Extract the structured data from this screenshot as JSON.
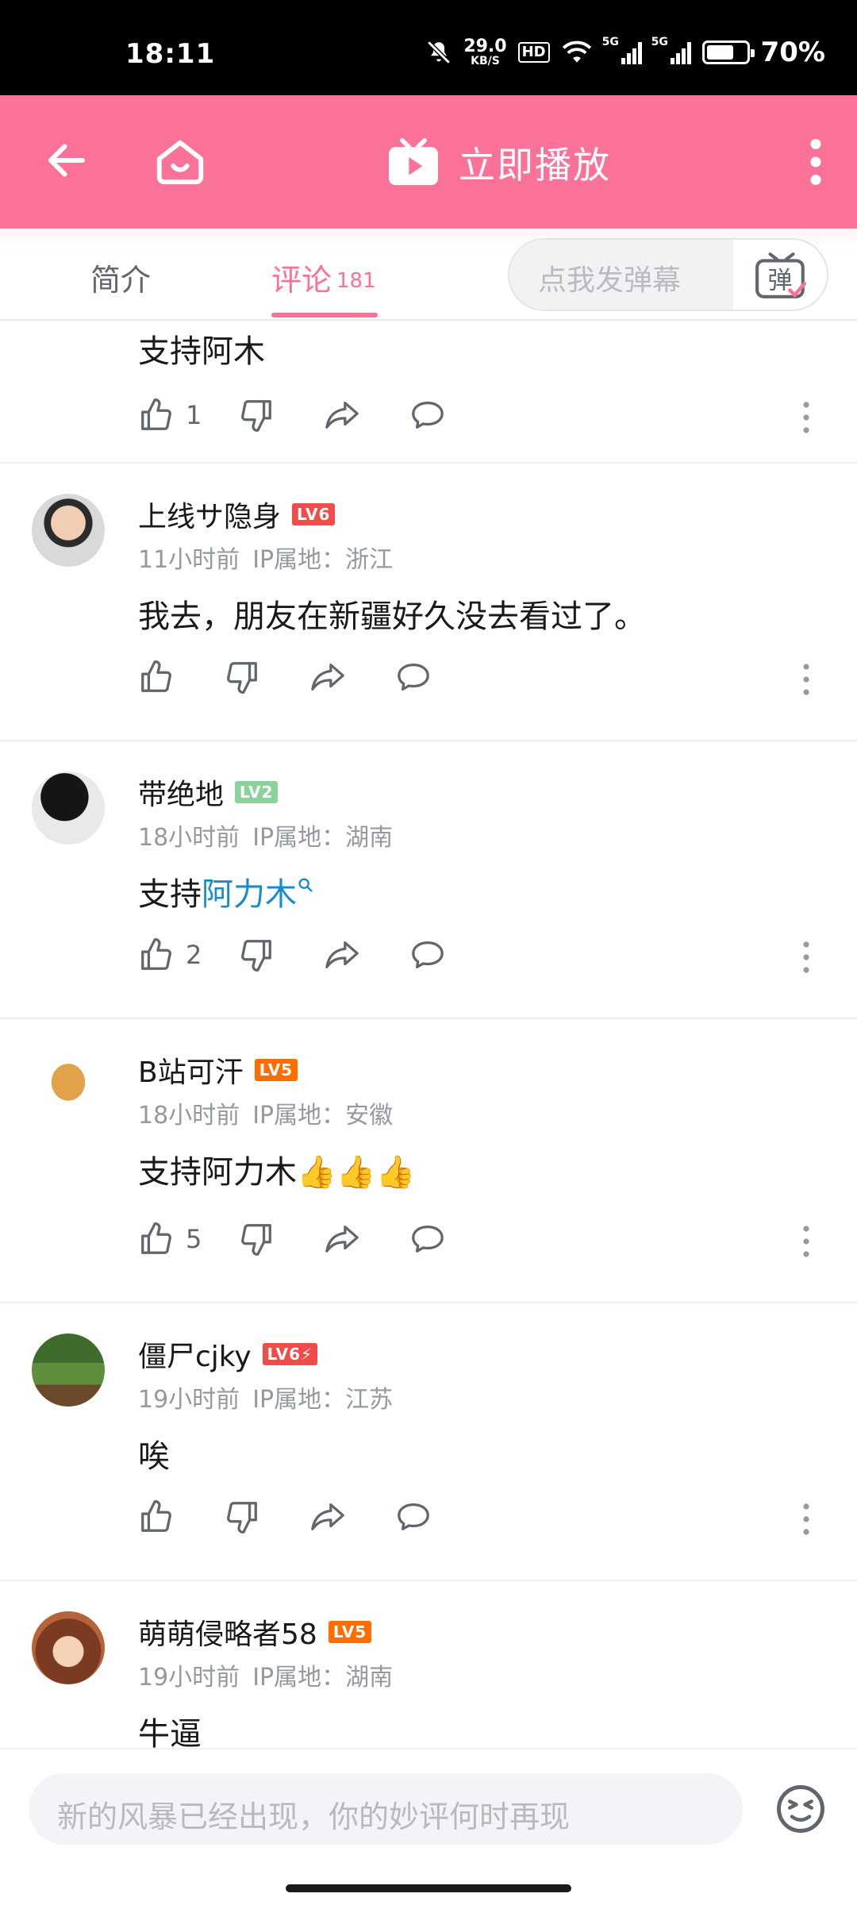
{
  "status_bar": {
    "time": "18:11",
    "net_speed": "29.0",
    "net_unit": "KB/S",
    "hd": "HD",
    "signal1": "5G",
    "signal2": "5G",
    "battery": "70%",
    "battery_level": 0.7
  },
  "header": {
    "back_icon": "arrow-left-icon",
    "home_icon": "home-icon",
    "play_label": "立即播放",
    "play_icon": "tv-play-icon",
    "more_icon": "more-vertical-icon",
    "accent": "#fb7299"
  },
  "tabs": {
    "intro": "简介",
    "comments": "评论",
    "comments_count": "181",
    "danmaku_placeholder": "点我发弹幕",
    "danmaku_icon": "弹"
  },
  "comments": [
    {
      "text": "支持阿木",
      "likes": "1"
    },
    {
      "username": "上线サ隐身",
      "level": "LV6",
      "level_color": "#f04c49",
      "time": "11小时前",
      "ip": "IP属地：浙江",
      "text": "我去，朋友在新疆好久没去看过了。",
      "likes": ""
    },
    {
      "username": "带绝地",
      "level": "LV2",
      "level_color": "#8bd29b",
      "time": "18小时前",
      "ip": "IP属地：湖南",
      "text_prefix": "支持",
      "text_link": "阿力木",
      "likes": "2"
    },
    {
      "username": "B站可汗",
      "level": "LV5",
      "level_color": "#ff6c00",
      "time": "18小时前",
      "ip": "IP属地：安徽",
      "text": "支持阿力木👍👍👍",
      "likes": "5"
    },
    {
      "username": "僵尸cjky",
      "level": "LV6⚡",
      "level_color": "#f04c49",
      "time": "19小时前",
      "ip": "IP属地：江苏",
      "text": "唉",
      "likes": ""
    },
    {
      "username": "萌萌侵略者58",
      "level": "LV5",
      "level_color": "#ff6c00",
      "time": "19小时前",
      "ip": "IP属地：湖南",
      "text": "牛逼",
      "likes": ""
    }
  ],
  "bottom": {
    "placeholder": "新的风暴已经出现，你的妙评何时再现",
    "emoji_icon": "emoji-face-icon"
  }
}
